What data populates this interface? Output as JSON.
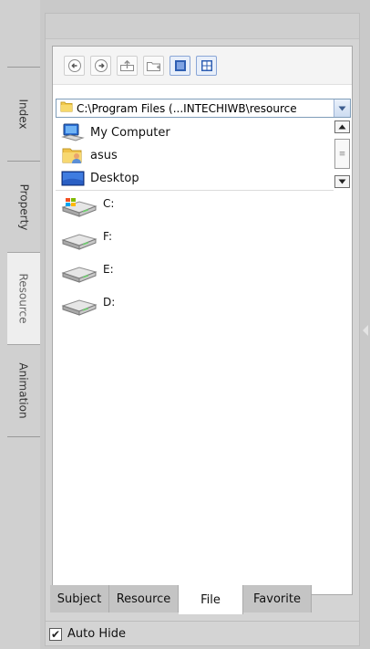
{
  "side_tabs": [
    {
      "label": "Index"
    },
    {
      "label": "Property"
    },
    {
      "label": "Resource"
    },
    {
      "label": "Animation"
    }
  ],
  "active_side_tab": "Resource",
  "toolbar": {
    "buttons": [
      {
        "name": "back-button",
        "icon": "arrow-left-icon"
      },
      {
        "name": "forward-button",
        "icon": "arrow-right-icon"
      },
      {
        "name": "up-button",
        "icon": "folder-up-icon"
      },
      {
        "name": "new-folder-button",
        "icon": "new-folder-icon"
      },
      {
        "name": "list-view-button",
        "icon": "list-view-icon"
      },
      {
        "name": "thumbnail-view-button",
        "icon": "thumbnail-view-icon"
      }
    ]
  },
  "path": {
    "value": "C:\\Program Files (...INTECHIWB\\resource"
  },
  "folders": [
    {
      "label": "My Computer",
      "icon": "computer-icon"
    },
    {
      "label": "asus",
      "icon": "user-folder-icon"
    },
    {
      "label": "Desktop",
      "icon": "desktop-icon"
    }
  ],
  "drives": [
    {
      "label": "C:",
      "icon": "windows-drive-icon"
    },
    {
      "label": "F:",
      "icon": "drive-icon"
    },
    {
      "label": "E:",
      "icon": "drive-icon"
    },
    {
      "label": "D:",
      "icon": "drive-icon"
    }
  ],
  "bottom_tabs": [
    {
      "label": "Subject"
    },
    {
      "label": "Resource"
    },
    {
      "label": "File"
    },
    {
      "label": "Favorite"
    }
  ],
  "active_bottom_tab": "File",
  "autohide": {
    "label": "Auto Hide",
    "checked": true
  },
  "colors": {
    "accent": "#2f5fb3",
    "panel_bg": "#d4d4d4"
  }
}
